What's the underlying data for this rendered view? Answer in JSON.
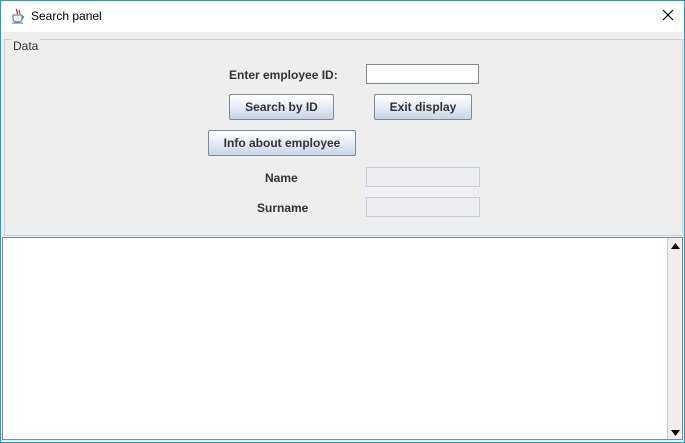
{
  "window": {
    "title": "Search panel"
  },
  "panel": {
    "legend": "Data",
    "employee_id_label": "Enter employee ID:",
    "employee_id_value": "",
    "name_label": "Name",
    "name_value": "",
    "surname_label": "Surname",
    "surname_value": ""
  },
  "buttons": {
    "search_by_id": "Search by ID",
    "exit_display": "Exit display",
    "info_about_employee": "Info about employee"
  },
  "output": {
    "text": ""
  },
  "icons": {
    "app": "java-cup-icon",
    "close": "close-icon",
    "scroll_up": "scroll-up-arrow-icon",
    "scroll_down": "scroll-down-arrow-icon"
  }
}
